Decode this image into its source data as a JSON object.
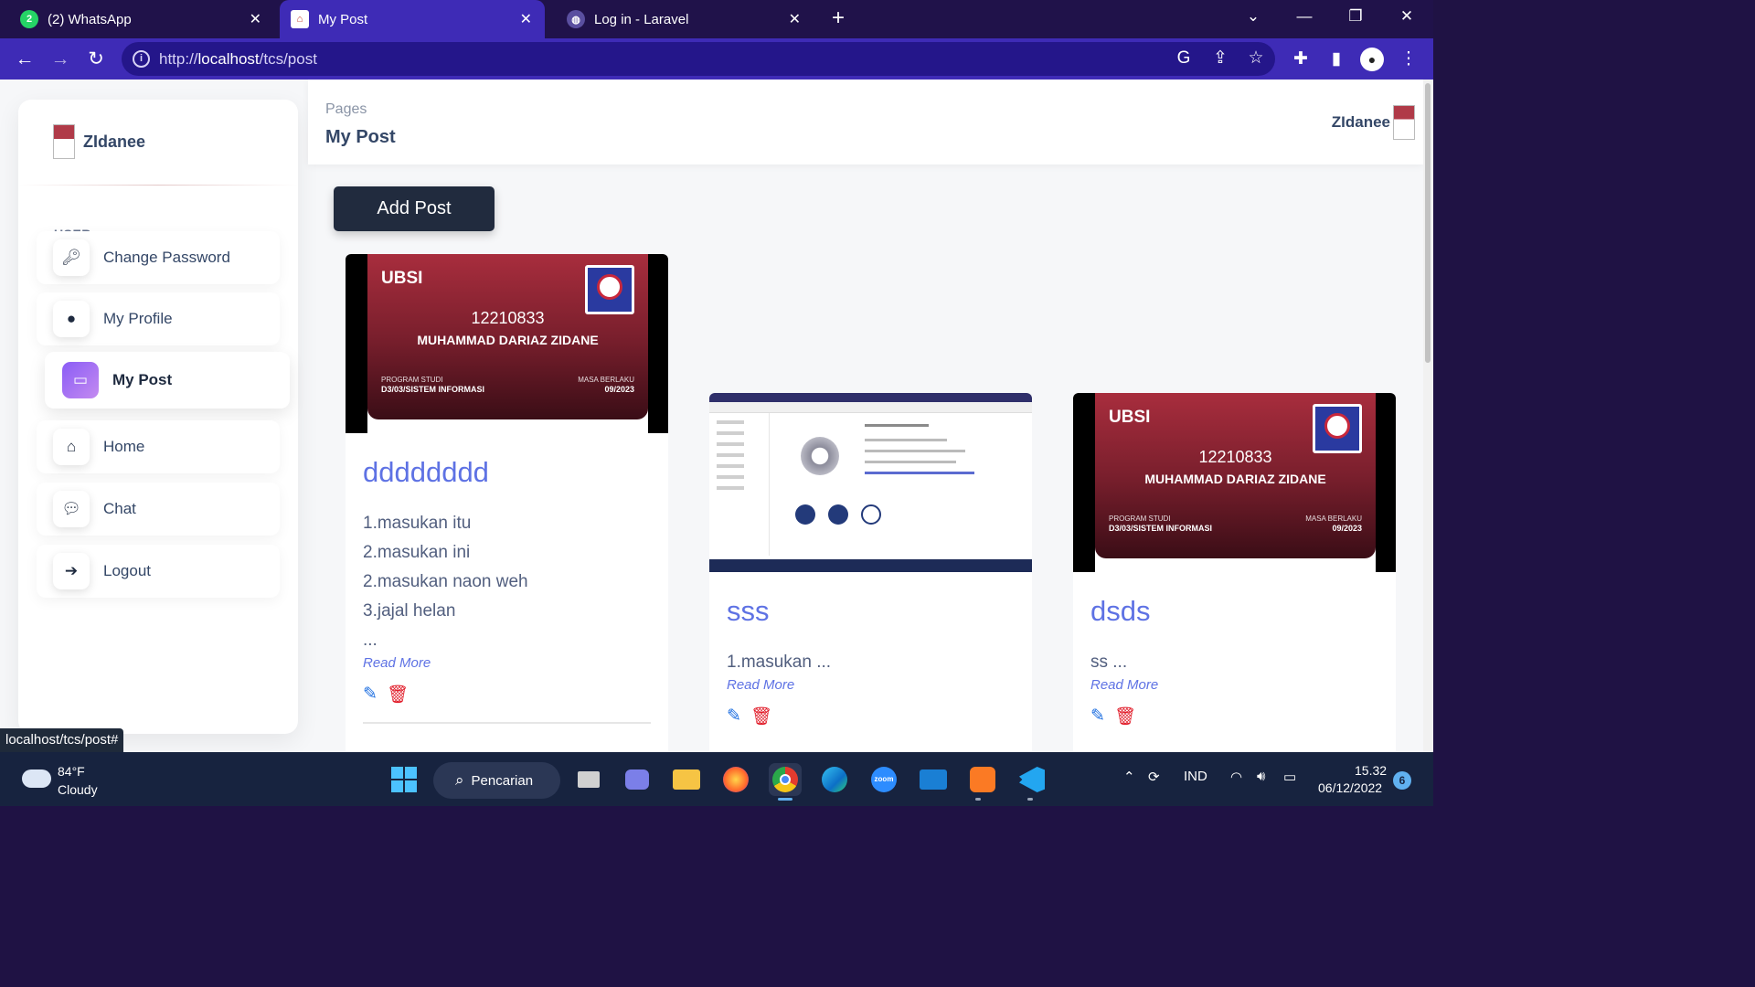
{
  "browser": {
    "tabs": [
      {
        "title": "(2) WhatsApp",
        "badge": "2"
      },
      {
        "title": "My Post"
      },
      {
        "title": "Log in - Laravel"
      }
    ],
    "url_prefix": "http://",
    "url_host": "localhost",
    "url_path": "/tcs/post",
    "status_link": "localhost/tcs/post#"
  },
  "brand": {
    "name": "ZIdanee"
  },
  "sidebar": {
    "section_label": "USER",
    "items": [
      {
        "label": "Change Password",
        "icon": "key-icon"
      },
      {
        "label": "My Profile",
        "icon": "user-icon"
      },
      {
        "label": "My Post",
        "icon": "folder-open-icon",
        "active": true
      },
      {
        "label": "Home",
        "icon": "home-icon"
      },
      {
        "label": "Chat",
        "icon": "chat-icon"
      },
      {
        "label": "Logout",
        "icon": "logout-icon"
      }
    ]
  },
  "header": {
    "breadcrumb": "Pages",
    "title": "My Post",
    "username": "ZIdanee"
  },
  "add_post_label": "Add Post",
  "id_card": {
    "university": "UBSI",
    "nim": "12210833",
    "name": "MUHAMMAD DARIAZ ZIDANE",
    "program_label": "PROGRAM STUDI",
    "program": "D3/03/SISTEM INFORMASI",
    "valid_label": "MASA BERLAKU",
    "valid": "09/2023"
  },
  "posts": [
    {
      "title": "dddddddd",
      "lines": [
        "1.masukan itu",
        "2.masukan ini",
        "2.masukan naon weh",
        "3.jajal helan",
        "..."
      ],
      "read_more": "Read More"
    },
    {
      "title": "sss",
      "lines": [
        "1.masukan ..."
      ],
      "read_more": "Read More"
    },
    {
      "title": "dsds",
      "lines": [
        "ss ..."
      ],
      "read_more": "Read More"
    }
  ],
  "taskbar": {
    "temperature": "84°F",
    "condition": "Cloudy",
    "search_label": "Pencarian",
    "language": "IND",
    "time": "15.32",
    "date": "06/12/2022",
    "notifications": "6"
  }
}
